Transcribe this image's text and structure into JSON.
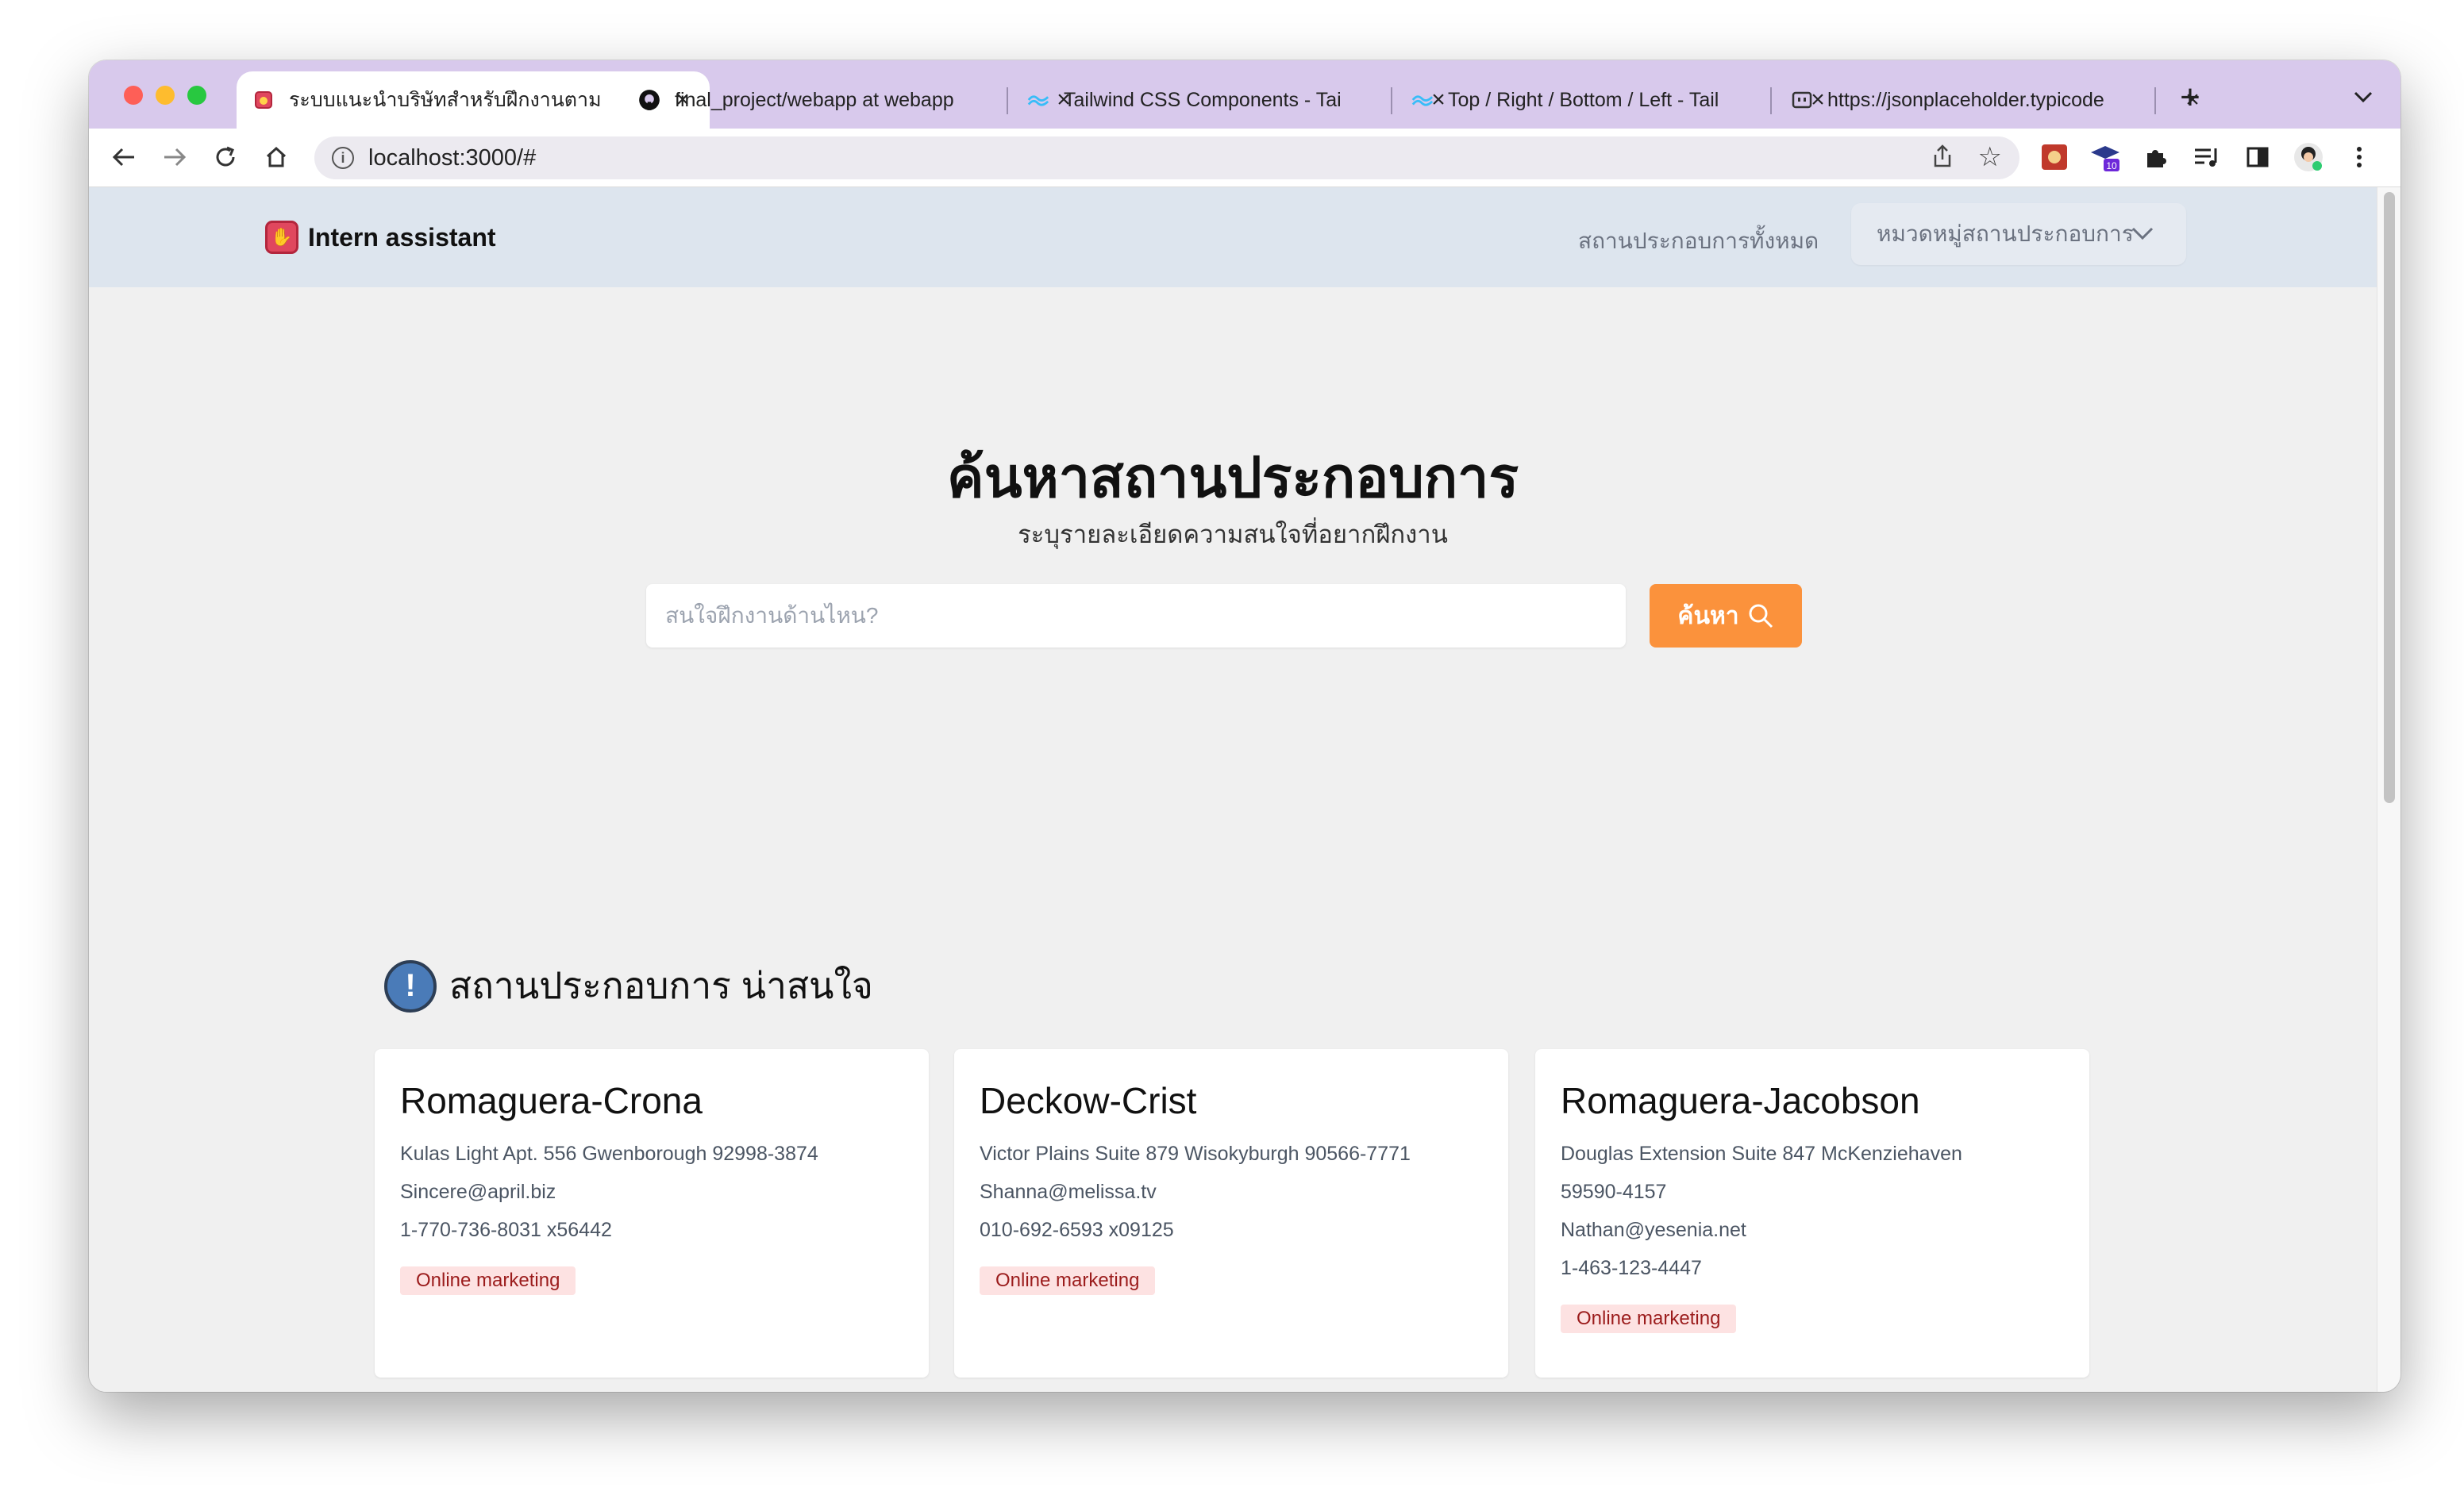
{
  "browser": {
    "tabs": [
      {
        "title": "ระบบแนะนำบริษัทสำหรับฝึกงานตาม",
        "favicon": "intern-hand-icon",
        "active": true
      },
      {
        "title": "final_project/webapp at webapp",
        "favicon": "github-icon",
        "active": false
      },
      {
        "title": "Tailwind CSS Components - Tai",
        "favicon": "tailwind-icon",
        "active": false
      },
      {
        "title": "Top / Right / Bottom / Left - Tail",
        "favicon": "tailwind-icon",
        "active": false
      },
      {
        "title": "https://jsonplaceholder.typicode",
        "favicon": "json-icon",
        "active": false
      }
    ],
    "url": "localhost:3000/#",
    "extension_badge": "10"
  },
  "navbar": {
    "brand": "Intern assistant",
    "link_all": "สถานประกอบการทั้งหมด",
    "dropdown_label": "หมวดหมู่สถานประกอบการ"
  },
  "hero": {
    "title": "ค้นหาสถานประกอบการ",
    "subtitle": "ระบุรายละเอียดความสนใจที่อยากฝึกงาน",
    "search_placeholder": "สนใจฝึกงานด้านไหน?",
    "search_button": "ค้นหา"
  },
  "section": {
    "title": "สถานประกอบการ น่าสนใจ"
  },
  "companies": [
    {
      "name": "Romaguera-Crona",
      "lines": [
        "Kulas Light Apt. 556 Gwenborough 92998-3874",
        "Sincere@april.biz",
        "1-770-736-8031 x56442"
      ],
      "tag": "Online marketing"
    },
    {
      "name": "Deckow-Crist",
      "lines": [
        "Victor Plains Suite 879 Wisokyburgh 90566-7771",
        "Shanna@melissa.tv",
        "010-692-6593 x09125"
      ],
      "tag": "Online marketing"
    },
    {
      "name": "Romaguera-Jacobson",
      "lines": [
        "Douglas Extension Suite 847 McKenziehaven",
        "59590-4157",
        "Nathan@yesenia.net",
        "1-463-123-4447"
      ],
      "tag": "Online marketing"
    }
  ],
  "colors": {
    "accent": "#fb923c",
    "navbar_bg": "#dde5ee",
    "tag_bg": "#fde2e2",
    "tag_text": "#9b1c1c"
  }
}
